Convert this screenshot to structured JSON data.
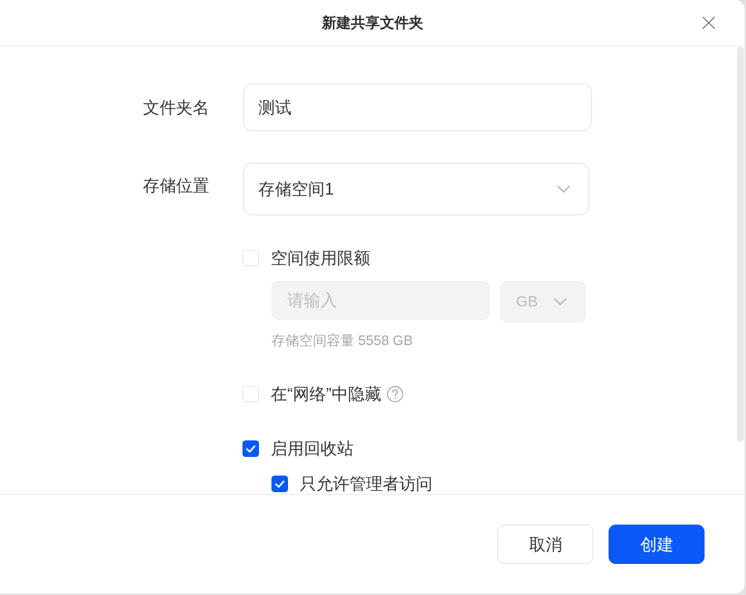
{
  "dialog": {
    "title": "新建共享文件夹"
  },
  "form": {
    "name_field": {
      "label": "文件夹名",
      "value": "测试"
    },
    "location_field": {
      "label": "存储位置",
      "value": "存储空间1"
    },
    "options": [
      {
        "label": "空间使用限额",
        "checked": false,
        "quota": {
          "input": {
            "placeholder": "请输入",
            "disabled": true
          },
          "unit": {
            "value": "GB",
            "disabled": true
          },
          "hint": "存储空间容量 5558 GB"
        }
      },
      {
        "label": "在“网络”中隐藏",
        "checked": false,
        "help": true
      },
      {
        "label": "启用回收站",
        "checked": true,
        "children": [
          {
            "label": "只允许管理者访问",
            "checked": true
          }
        ]
      }
    ]
  },
  "buttons": [
    {
      "label": "取消",
      "kind": "secondary"
    },
    {
      "label": "创建",
      "kind": "primary"
    }
  ]
}
